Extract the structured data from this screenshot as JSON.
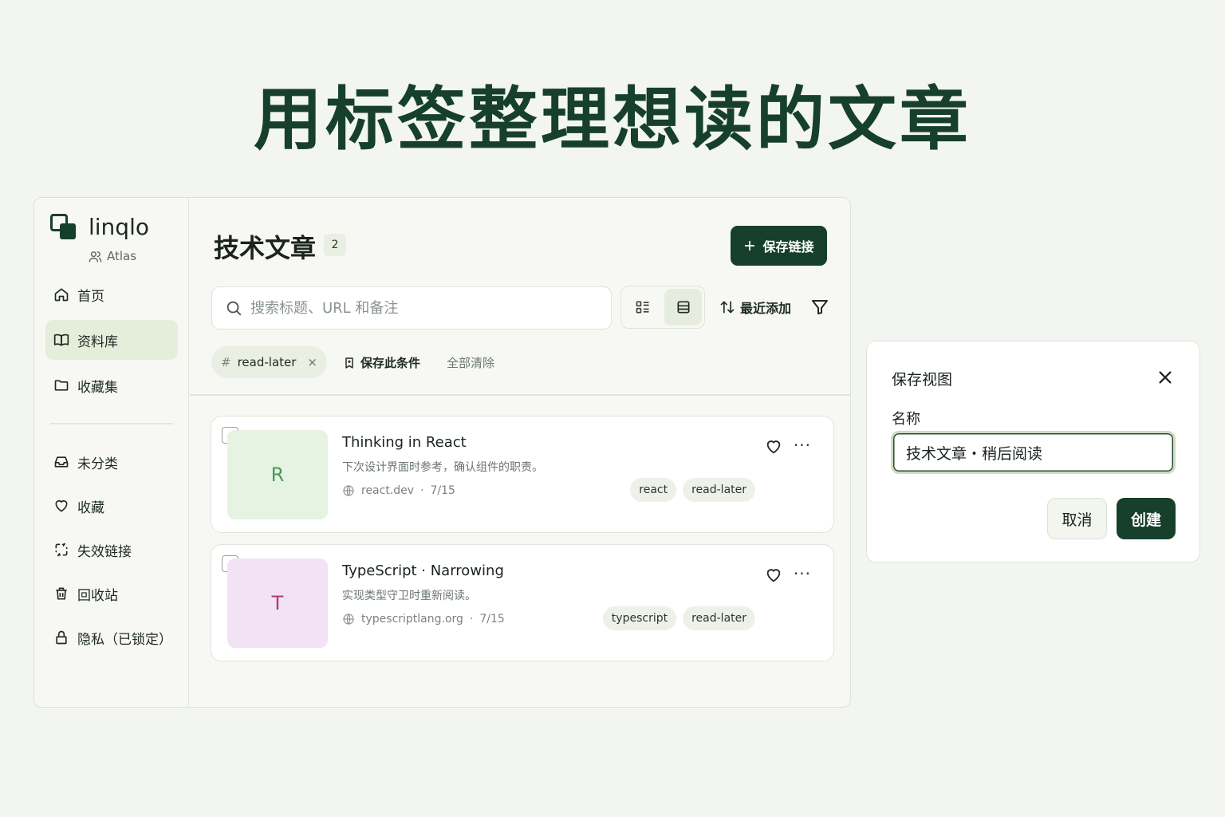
{
  "headline": "用标签整理想读的文章",
  "sidebar": {
    "brand": "linqlo",
    "workspace": "Atlas",
    "items": [
      {
        "label": "首页",
        "icon": "home-icon"
      },
      {
        "label": "资料库",
        "icon": "book-icon",
        "active": true
      },
      {
        "label": "收藏集",
        "icon": "folder-icon"
      },
      {
        "label": "未分类",
        "icon": "inbox-icon"
      },
      {
        "label": "收藏",
        "icon": "heart-icon"
      },
      {
        "label": "失效链接",
        "icon": "broken-link-icon"
      },
      {
        "label": "回收站",
        "icon": "trash-icon"
      },
      {
        "label": "隐私（已锁定）",
        "icon": "lock-icon"
      }
    ]
  },
  "main": {
    "title": "技术文章",
    "count": "2",
    "save_link_label": "保存链接",
    "search_placeholder": "搜索标题、URL 和备注",
    "sort_label": "最近添加",
    "active_filter": {
      "hash": "#",
      "tag": "read-later",
      "remove": "×"
    },
    "save_condition_label": "保存此条件",
    "clear_all_label": "全部清除",
    "cards": [
      {
        "initial": "R",
        "title": "Thinking in React",
        "desc": "下次设计界面时参考，确认组件的职责。",
        "domain": "react.dev",
        "sep": "·",
        "date": "7/15",
        "tags": [
          "react",
          "read-later"
        ],
        "thumb_bg": "#e6f2e2",
        "thumb_fg": "#4d9a5a"
      },
      {
        "initial": "T",
        "title": "TypeScript · Narrowing",
        "desc": "实现类型守卫时重新阅读。",
        "domain": "typescriptlang.org",
        "sep": "·",
        "date": "7/15",
        "tags": [
          "typescript",
          "read-later"
        ],
        "thumb_bg": "#f1e3f3",
        "thumb_fg": "#b23a6e"
      }
    ]
  },
  "dialog": {
    "title": "保存视图",
    "name_label": "名称",
    "name_value": "技术文章・稍后阅读",
    "cancel_label": "取消",
    "create_label": "创建"
  },
  "colors": {
    "accent": "#163f2c",
    "active_nav_bg": "#e4eedb",
    "page_bg": "#f3f5f0"
  }
}
